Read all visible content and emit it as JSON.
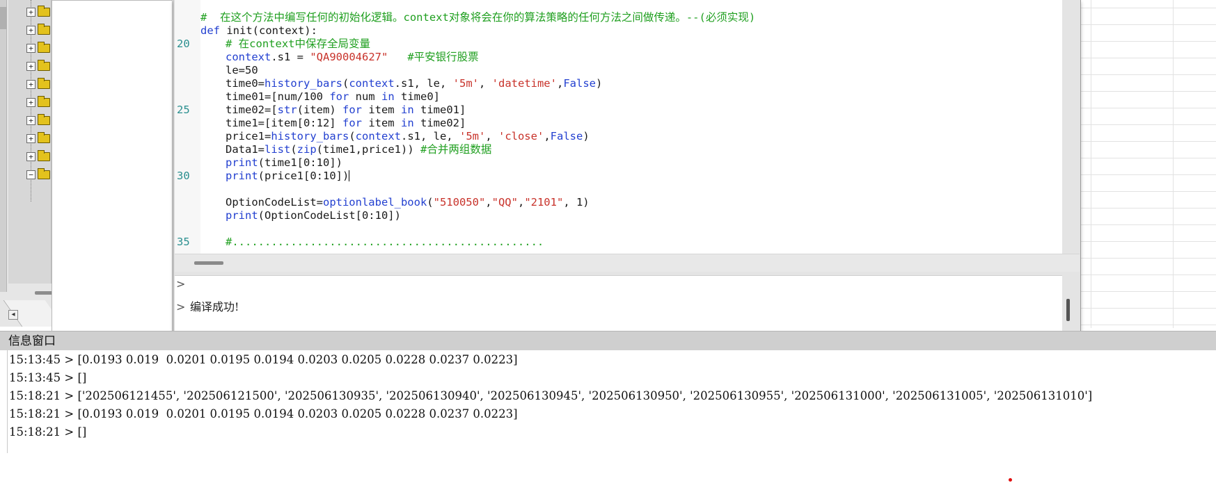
{
  "tree": {
    "rows": [
      {
        "toggle": "+"
      },
      {
        "toggle": "+"
      },
      {
        "toggle": "+"
      },
      {
        "toggle": "+"
      },
      {
        "toggle": "+"
      },
      {
        "toggle": "+"
      },
      {
        "toggle": "+"
      },
      {
        "toggle": "+"
      },
      {
        "toggle": "+"
      },
      {
        "toggle": "−"
      }
    ],
    "scroll_left_icon": "◂"
  },
  "editor": {
    "line_numbers": [
      {
        "n": "20",
        "line": 3
      },
      {
        "n": "25",
        "line": 8
      },
      {
        "n": "30",
        "line": 13
      },
      {
        "n": "35",
        "line": 18
      }
    ],
    "lines": [
      {
        "parts": [
          {
            "t": "#  在这个方法中编写任何的初始化逻辑。context对象将会在你的算法策略的任何方法之间做传递。--(必须实现)",
            "c": "cm"
          }
        ],
        "indent": 0
      },
      {
        "parts": [
          {
            "t": "def ",
            "c": "kw"
          },
          {
            "t": "init(context):",
            "c": ""
          }
        ],
        "indent": 0
      },
      {
        "parts": [
          {
            "t": "# 在context中保存全局变量",
            "c": "cm"
          }
        ],
        "indent": 1
      },
      {
        "parts": [
          {
            "t": "context",
            "c": "kw"
          },
          {
            "t": ".s1 = ",
            "c": ""
          },
          {
            "t": "\"QA90004627\"",
            "c": "str"
          },
          {
            "t": "   ",
            "c": ""
          },
          {
            "t": "#平安银行股票",
            "c": "cm"
          }
        ],
        "indent": 1
      },
      {
        "parts": [
          {
            "t": "le=50",
            "c": ""
          }
        ],
        "indent": 1
      },
      {
        "parts": [
          {
            "t": "time0=",
            "c": ""
          },
          {
            "t": "history_bars",
            "c": "fn"
          },
          {
            "t": "(",
            "c": ""
          },
          {
            "t": "context",
            "c": "kw"
          },
          {
            "t": ".s1, le, ",
            "c": ""
          },
          {
            "t": "'5m'",
            "c": "str"
          },
          {
            "t": ", ",
            "c": ""
          },
          {
            "t": "'datetime'",
            "c": "str"
          },
          {
            "t": ",",
            "c": ""
          },
          {
            "t": "False",
            "c": "kw"
          },
          {
            "t": ")",
            "c": ""
          }
        ],
        "indent": 1
      },
      {
        "parts": [
          {
            "t": "time01=[num/100 ",
            "c": ""
          },
          {
            "t": "for",
            "c": "kw"
          },
          {
            "t": " num ",
            "c": ""
          },
          {
            "t": "in",
            "c": "kw"
          },
          {
            "t": " time0]",
            "c": ""
          }
        ],
        "indent": 1
      },
      {
        "parts": [
          {
            "t": "time02=[",
            "c": ""
          },
          {
            "t": "str",
            "c": "fn"
          },
          {
            "t": "(item) ",
            "c": ""
          },
          {
            "t": "for",
            "c": "kw"
          },
          {
            "t": " item ",
            "c": ""
          },
          {
            "t": "in",
            "c": "kw"
          },
          {
            "t": " time01]",
            "c": ""
          }
        ],
        "indent": 1
      },
      {
        "parts": [
          {
            "t": "time1=[item[0:12] ",
            "c": ""
          },
          {
            "t": "for",
            "c": "kw"
          },
          {
            "t": " item ",
            "c": ""
          },
          {
            "t": "in",
            "c": "kw"
          },
          {
            "t": " time02]",
            "c": ""
          }
        ],
        "indent": 1
      },
      {
        "parts": [
          {
            "t": "price1=",
            "c": ""
          },
          {
            "t": "history_bars",
            "c": "fn"
          },
          {
            "t": "(",
            "c": ""
          },
          {
            "t": "context",
            "c": "kw"
          },
          {
            "t": ".s1, le, ",
            "c": ""
          },
          {
            "t": "'5m'",
            "c": "str"
          },
          {
            "t": ", ",
            "c": ""
          },
          {
            "t": "'close'",
            "c": "str"
          },
          {
            "t": ",",
            "c": ""
          },
          {
            "t": "False",
            "c": "kw"
          },
          {
            "t": ")",
            "c": ""
          }
        ],
        "indent": 1
      },
      {
        "parts": [
          {
            "t": "Data1=",
            "c": ""
          },
          {
            "t": "list",
            "c": "fn"
          },
          {
            "t": "(",
            "c": ""
          },
          {
            "t": "zip",
            "c": "fn"
          },
          {
            "t": "(time1,price1)) ",
            "c": ""
          },
          {
            "t": "#合并两组数据",
            "c": "cm"
          }
        ],
        "indent": 1
      },
      {
        "parts": [
          {
            "t": "print",
            "c": "fn"
          },
          {
            "t": "(time1[0:10])",
            "c": ""
          }
        ],
        "indent": 1
      },
      {
        "parts": [
          {
            "t": "print",
            "c": "fn"
          },
          {
            "t": "(price1[0:10])",
            "c": ""
          }
        ],
        "indent": 1,
        "caret": true
      },
      {
        "parts": [],
        "indent": 1
      },
      {
        "parts": [
          {
            "t": "OptionCodeList=",
            "c": ""
          },
          {
            "t": "optionlabel_book",
            "c": "fn"
          },
          {
            "t": "(",
            "c": ""
          },
          {
            "t": "\"510050\"",
            "c": "str"
          },
          {
            "t": ",",
            "c": ""
          },
          {
            "t": "\"QQ\"",
            "c": "str"
          },
          {
            "t": ",",
            "c": ""
          },
          {
            "t": "\"2101\"",
            "c": "str"
          },
          {
            "t": ", 1)",
            "c": ""
          }
        ],
        "indent": 1
      },
      {
        "parts": [
          {
            "t": "print",
            "c": "fn"
          },
          {
            "t": "(OptionCodeList[0:10])",
            "c": ""
          }
        ],
        "indent": 1
      },
      {
        "parts": [],
        "indent": 1
      },
      {
        "parts": [
          {
            "t": "#................................................",
            "c": "cm"
          }
        ],
        "indent": 1
      }
    ]
  },
  "output": {
    "lines": [
      {
        "prompt": ">",
        "text": ""
      },
      {
        "prompt": ">",
        "text": "编译成功!"
      }
    ]
  },
  "info_window": {
    "title": "信息窗口",
    "logs": [
      {
        "time": "15:13:45",
        "text": "[0.0193 0.019  0.0201 0.0195 0.0194 0.0203 0.0205 0.0228 0.0237 0.0223]"
      },
      {
        "time": "15:13:45",
        "text": "[]"
      },
      {
        "time": "15:18:21",
        "text": "['202506121455', '202506121500', '202506130935', '202506130940', '202506130945', '202506130950', '202506130955', '202506131000', '202506131005', '202506131010']"
      },
      {
        "time": "15:18:21",
        "text": "[0.0193 0.019  0.0201 0.0195 0.0194 0.0203 0.0205 0.0228 0.0237 0.0223]"
      },
      {
        "time": "15:18:21",
        "text": "[]"
      }
    ]
  }
}
